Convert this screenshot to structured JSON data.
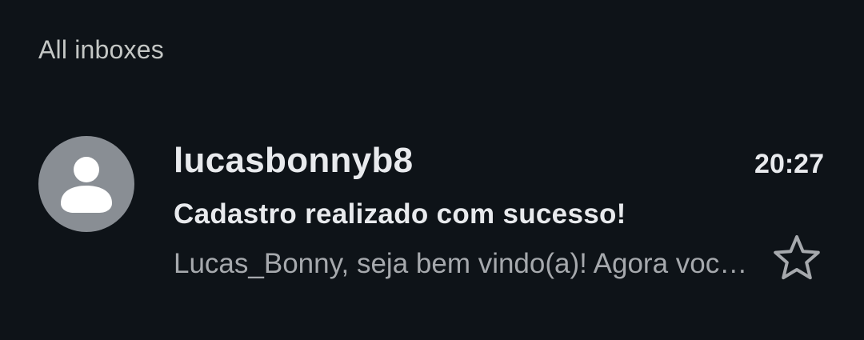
{
  "section": {
    "label": "All inboxes"
  },
  "email": {
    "sender": "lucasbonnyb8",
    "time": "20:27",
    "subject": "Cadastro realizado com sucesso!",
    "snippet": "Lucas_Bonny, seja bem vindo(a)! Agora você faz parte da nossa comunidade",
    "avatar_icon": "person-icon",
    "star_icon": "star-outline-icon",
    "starred": false
  },
  "colors": {
    "background": "#0e1318",
    "primary_text": "#e8eaed",
    "secondary_text": "#a6a9ad",
    "avatar_background": "#898e94"
  }
}
